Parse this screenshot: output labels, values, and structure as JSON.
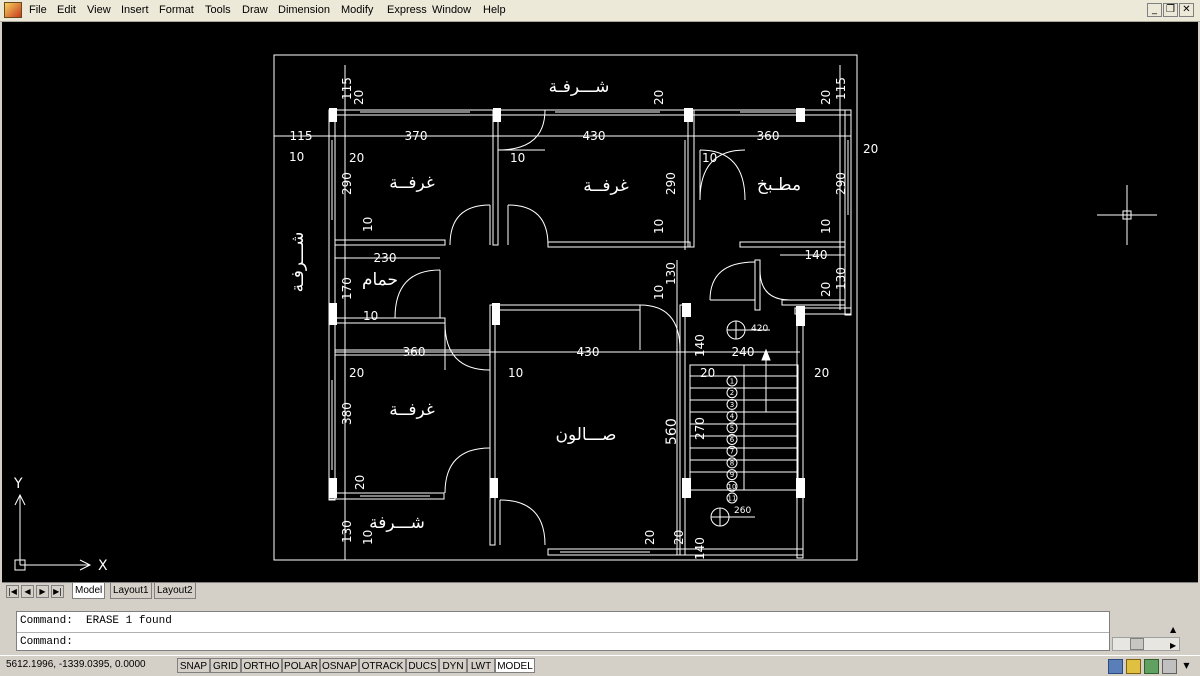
{
  "menu": {
    "items": [
      "File",
      "Edit",
      "View",
      "Insert",
      "Format",
      "Tools",
      "Draw",
      "Dimension",
      "Modify",
      "Express",
      "Window",
      "Help"
    ]
  },
  "drawing": {
    "room_labels": {
      "balcony_top": "شـــرفـة",
      "balcony_left": "شـــرفـة",
      "balcony_bottom": "شـــرفة",
      "room1": "غرفــة",
      "room2": "غرفــة",
      "room3": "غرفــة",
      "kitchen": "مطـبخ",
      "bathroom": "حمام",
      "salon": "صـــالون"
    },
    "dims": {
      "d115_left": "115",
      "d370": "370",
      "d430_top": "430",
      "d360_top": "360",
      "d115_top_left": "115",
      "d115_top_right": "115",
      "d20_a": "20",
      "d20_b": "20",
      "d20_c": "20",
      "d20_d": "20",
      "d20_e": "20",
      "d10_a": "10",
      "d10_b": "10",
      "d10_c": "10",
      "d20_f": "20",
      "d290_a": "290",
      "d290_b": "290",
      "d290_c": "290",
      "d10_d": "10",
      "d10_e": "10",
      "d10_f": "10",
      "d230": "230",
      "d170": "170",
      "d10_g": "10",
      "d140_a": "140",
      "d130_a": "130",
      "d20_g": "20",
      "d130_b": "130",
      "d10_h": "10",
      "d360_mid": "360",
      "d430_mid": "430",
      "d10_i": "10",
      "d140_b": "140",
      "d240": "240",
      "d20_h": "20",
      "d20_i": "20",
      "d420": "420",
      "d380": "380",
      "d20_j": "20",
      "d560": "560",
      "d270": "270",
      "d130_c": "130",
      "d10_j": "10",
      "d20_k": "20",
      "d20_l": "20",
      "d140_c": "140",
      "d260": "260"
    },
    "steps": [
      "1",
      "2",
      "3",
      "4",
      "5",
      "6",
      "7",
      "8",
      "9",
      "10",
      "11"
    ]
  },
  "ucs": {
    "x_label": "X",
    "y_label": "Y"
  },
  "tabs": {
    "model": "Model",
    "layout1": "Layout1",
    "layout2": "Layout2"
  },
  "command": {
    "history": "Command:  ERASE 1 found",
    "prompt": "Command:"
  },
  "status": {
    "coords": "5612.1996, -1339.0395, 0.0000",
    "buttons": [
      "SNAP",
      "GRID",
      "ORTHO",
      "POLAR",
      "OSNAP",
      "OTRACK",
      "DUCS",
      "DYN",
      "LWT",
      "MODEL"
    ]
  },
  "colors": {
    "canvas": "#000000",
    "lines": "#ffffff",
    "chrome": "#d4d0c8"
  }
}
